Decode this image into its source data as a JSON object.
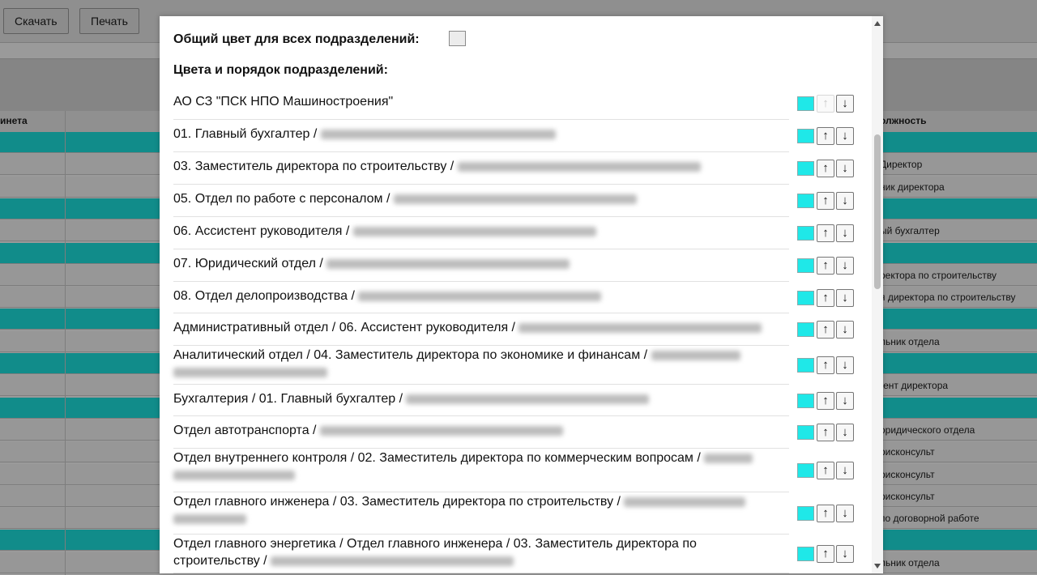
{
  "toolbar": {
    "download_label": "Скачать",
    "print_label": "Печать"
  },
  "background_table": {
    "header_left": "инета",
    "header_right": "олжность",
    "rows": [
      {
        "type": "teal",
        "text": ""
      },
      {
        "type": "plain",
        "text": "Директор"
      },
      {
        "type": "plain",
        "text": "ник директора"
      },
      {
        "type": "teal",
        "text": ""
      },
      {
        "type": "plain",
        "text": "ый бухгалтер"
      },
      {
        "type": "teal",
        "text": ""
      },
      {
        "type": "plain",
        "text": "ректора по строительству"
      },
      {
        "type": "plain",
        "text": "я директора по строительству"
      },
      {
        "type": "teal",
        "text": ""
      },
      {
        "type": "plain",
        "text": "льник отдела"
      },
      {
        "type": "teal",
        "text": ""
      },
      {
        "type": "plain",
        "text": "гент директора"
      },
      {
        "type": "teal",
        "text": ""
      },
      {
        "type": "plain",
        "text": "оридического отдела"
      },
      {
        "type": "plain",
        "text": "рисконсульт"
      },
      {
        "type": "plain",
        "text": "рисконсульт"
      },
      {
        "type": "plain",
        "text": "рисконсульт"
      },
      {
        "type": "plain",
        "text": " по договорной работе"
      },
      {
        "type": "teal",
        "text": ""
      },
      {
        "type": "plain",
        "text": "льник отдела"
      }
    ]
  },
  "dialog": {
    "common_color_label": "Общий цвет для всех подразделений:",
    "common_color_value": "#ececec",
    "section_title": "Цвета и порядок подразделений:",
    "department_color": "#1fe8e8",
    "up_arrow": "↑",
    "down_arrow": "↓",
    "departments": [
      {
        "name": "АО СЗ \"ПСК НПО Машиностроения\"",
        "blurred": false
      },
      {
        "name": "01. Главный бухгалтер / ",
        "blurred": true
      },
      {
        "name": "03. Заместитель директора по строительству / ",
        "blurred": true
      },
      {
        "name": "05. Отдел по работе с персоналом / ",
        "blurred": true
      },
      {
        "name": "06. Ассистент руководителя / ",
        "blurred": true
      },
      {
        "name": "07. Юридический отдел / ",
        "blurred": true
      },
      {
        "name": "08. Отдел делопроизводства / ",
        "blurred": true
      },
      {
        "name": "Административный отдел / 06. Ассистент руководителя / ",
        "blurred": true
      },
      {
        "name": "Аналитический отдел / 04. Заместитель директора по экономике и финансам / ",
        "blurred": true
      },
      {
        "name": "Бухгалтерия / 01. Главный бухгалтер / ",
        "blurred": true
      },
      {
        "name": "Отдел автотранспорта / ",
        "blurred": true
      },
      {
        "name": "Отдел внутреннего контроля / 02. Заместитель директора по коммерческим вопросам / ",
        "blurred": true
      },
      {
        "name": "Отдел главного инженера / 03. Заместитель директора по строительству / ",
        "blurred": true
      },
      {
        "name": "Отдел главного энергетика / Отдел главного инженера / 03. Заместитель директора по строительству / ",
        "blurred": true
      }
    ]
  }
}
